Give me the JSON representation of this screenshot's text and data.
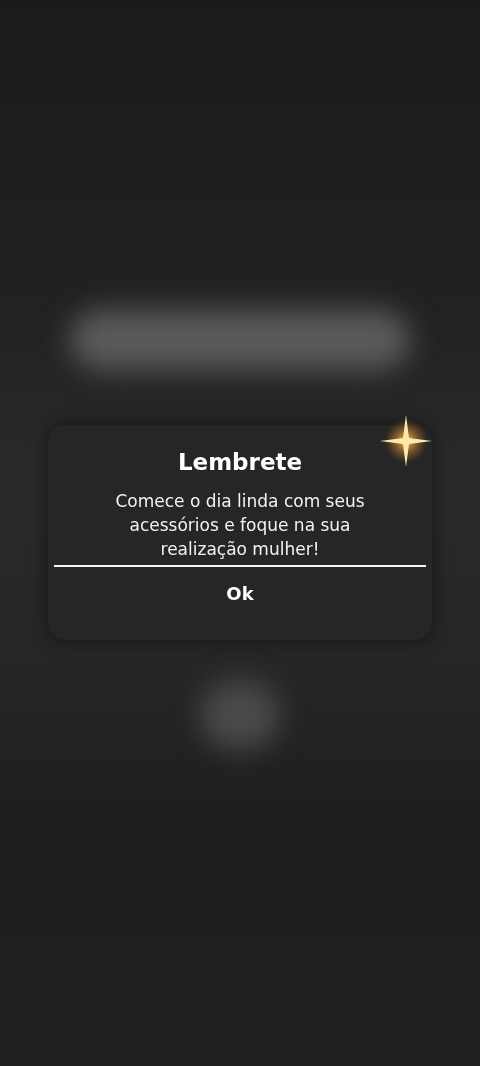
{
  "dialog": {
    "title": "Lembrete",
    "message": "Comece o dia linda com seus acessórios e foque na sua realização mulher!",
    "buttons": [
      "Ok"
    ]
  }
}
